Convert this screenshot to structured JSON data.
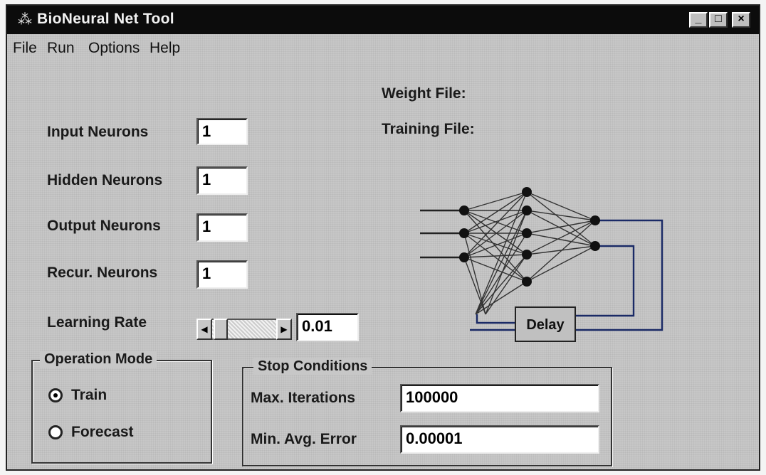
{
  "window": {
    "title": "BioNeural Net Tool",
    "app_icon": "network-app-icon",
    "controls": {
      "minimize": "_",
      "maximize": "□",
      "close": "×"
    }
  },
  "menu": [
    "File",
    "Run",
    "Options",
    "Help"
  ],
  "files": {
    "weight_label": "Weight File:",
    "training_label": "Training File:"
  },
  "neurons": {
    "input": {
      "label": "Input Neurons",
      "value": "1"
    },
    "hidden": {
      "label": "Hidden Neurons",
      "value": "1"
    },
    "output": {
      "label": "Output Neurons",
      "value": "1"
    },
    "recur": {
      "label": "Recur. Neurons",
      "value": "1"
    }
  },
  "learning_rate": {
    "label": "Learning Rate",
    "value": "0.01"
  },
  "operation_mode": {
    "title": "Operation Mode",
    "options": [
      "Train",
      "Forecast"
    ],
    "selected": "Train"
  },
  "stop_conditions": {
    "title": "Stop Conditions",
    "max_iterations_label": "Max. Iterations",
    "max_iterations_value": "100000",
    "min_avg_error_label": "Min. Avg. Error",
    "min_avg_error_value": "0.00001"
  },
  "diagram": {
    "delay_label": "Delay"
  },
  "colors": {
    "titlebar": "#0c0c0c",
    "window_bg": "#c7c7c7",
    "feedback_line": "#1a2a66"
  }
}
